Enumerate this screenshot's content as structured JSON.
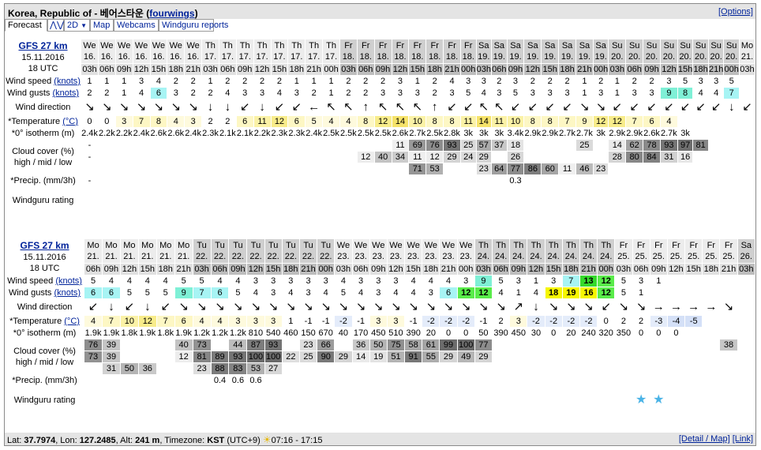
{
  "title": {
    "location": "Korea, Republic of - 베어스타운",
    "open_paren": "(",
    "user": "fourwings",
    "close_paren": ")"
  },
  "options_label": "[Options]",
  "tabs": {
    "forecast": "Forecast",
    "graph": "⋀⋁",
    "dim": "2D",
    "map": "Map",
    "webcams": "Webcams",
    "reports": "Windguru reports"
  },
  "row_labels": {
    "wind_speed": "Wind speed",
    "wind_speed_unit": "(knots)",
    "wind_gusts": "Wind gusts",
    "wind_gusts_unit": "(knots)",
    "wind_direction": "Wind direction",
    "temperature": "*Temperature",
    "temperature_unit": "(°C)",
    "isotherm": "*0° isotherm (m)",
    "cloud_cover_1": "Cloud cover (%)",
    "cloud_cover_2": "high / mid / low",
    "precip": "*Precip. (mm/3h)",
    "rating": "Windguru rating"
  },
  "blocks": [
    {
      "model": "GFS 27 km",
      "date": "15.11.2016",
      "utc": "18 UTC",
      "days": [
        "We",
        "We",
        "We",
        "We",
        "We",
        "We",
        "We",
        "Th",
        "Th",
        "Th",
        "Th",
        "Th",
        "Th",
        "Th",
        "Th",
        "Fr",
        "Fr",
        "Fr",
        "Fr",
        "Fr",
        "Fr",
        "Fr",
        "Fr",
        "Sa",
        "Sa",
        "Sa",
        "Sa",
        "Sa",
        "Sa",
        "Sa",
        "Sa",
        "Su",
        "Su",
        "Su",
        "Su",
        "Su",
        "Su",
        "Su",
        "Su",
        "Mo"
      ],
      "dates": [
        "16.",
        "16.",
        "16.",
        "16.",
        "16.",
        "16.",
        "16.",
        "17.",
        "17.",
        "17.",
        "17.",
        "17.",
        "17.",
        "17.",
        "17.",
        "18.",
        "18.",
        "18.",
        "18.",
        "18.",
        "18.",
        "18.",
        "18.",
        "19.",
        "19.",
        "19.",
        "19.",
        "19.",
        "19.",
        "19.",
        "19.",
        "20.",
        "20.",
        "20.",
        "20.",
        "20.",
        "20.",
        "20.",
        "20.",
        "21."
      ],
      "hours": [
        "03h",
        "06h",
        "09h",
        "12h",
        "15h",
        "18h",
        "21h",
        "03h",
        "06h",
        "09h",
        "12h",
        "15h",
        "18h",
        "21h",
        "00h",
        "03h",
        "06h",
        "09h",
        "12h",
        "15h",
        "18h",
        "21h",
        "00h",
        "03h",
        "06h",
        "09h",
        "12h",
        "15h",
        "18h",
        "21h",
        "00h",
        "03h",
        "06h",
        "09h",
        "12h",
        "15h",
        "18h",
        "21h",
        "00h",
        "03h"
      ],
      "weekend": [
        0,
        0,
        0,
        0,
        0,
        0,
        0,
        0,
        0,
        0,
        0,
        0,
        0,
        0,
        0,
        1,
        1,
        1,
        1,
        1,
        1,
        1,
        1,
        1,
        1,
        1,
        1,
        1,
        1,
        1,
        1,
        1,
        1,
        1,
        1,
        1,
        1,
        1,
        1,
        0
      ],
      "wind_speed": [
        "1",
        "1",
        "1",
        "3",
        "4",
        "2",
        "2",
        "1",
        "2",
        "2",
        "2",
        "2",
        "1",
        "1",
        "1",
        "2",
        "2",
        "2",
        "3",
        "1",
        "2",
        "4",
        "3",
        "3",
        "2",
        "3",
        "2",
        "2",
        "2",
        "1",
        "2",
        "1",
        "2",
        "2",
        "3",
        "5",
        "3",
        "3",
        "5",
        ""
      ],
      "wind_gusts": [
        "2",
        "2",
        "1",
        "4",
        "6",
        "3",
        "2",
        "2",
        "4",
        "3",
        "3",
        "4",
        "3",
        "2",
        "1",
        "2",
        "2",
        "3",
        "3",
        "3",
        "2",
        "3",
        "5",
        "4",
        "3",
        "5",
        "3",
        "3",
        "3",
        "1",
        "3",
        "1",
        "3",
        "3",
        "9",
        "8",
        "4",
        "4",
        "7",
        ""
      ],
      "wind_dir": [
        "↘",
        "↘",
        "↘",
        "↘",
        "↘",
        "↘",
        "↘",
        "↓",
        "↓",
        "↙",
        "↓",
        "↙",
        "↙",
        "←",
        "↖",
        "↖",
        "↑",
        "↖",
        "↖",
        "↖",
        "↑",
        "↙",
        "↙",
        "↖",
        "↖",
        "↙",
        "↙",
        "↙",
        "↙",
        "↘",
        "↘",
        "↙",
        "↙",
        "↙",
        "↙",
        "↙",
        "↙",
        "↙",
        "↓",
        "↙"
      ],
      "temperature": [
        "0",
        "0",
        "3",
        "7",
        "8",
        "4",
        "3",
        "2",
        "2",
        "6",
        "11",
        "12",
        "6",
        "5",
        "4",
        "4",
        "8",
        "12",
        "14",
        "10",
        "8",
        "8",
        "11",
        "14",
        "11",
        "10",
        "8",
        "8",
        "7",
        "9",
        "12",
        "12",
        "7",
        "6",
        "4",
        "",
        "",
        "",
        "",
        ""
      ],
      "isotherm": [
        "2.4k",
        "2.2k",
        "2.2k",
        "2.4k",
        "2.6k",
        "2.6k",
        "2.4k",
        "2.3k",
        "2.1k",
        "2.1k",
        "2.2k",
        "2.3k",
        "2.3k",
        "2.4k",
        "2.5k",
        "2.5k",
        "2.5k",
        "2.5k",
        "2.6k",
        "2.7k",
        "2.5k",
        "2.8k",
        "3k",
        "3k",
        "3k",
        "3.4k",
        "2.9k",
        "2.9k",
        "2.7k",
        "2.7k",
        "3k",
        "2.9k",
        "2.9k",
        "2.6k",
        "2.7k",
        "3k",
        "",
        "",
        "",
        ""
      ],
      "cloud_high": [
        "-",
        "",
        "",
        "",
        "",
        "",
        "",
        "",
        "",
        "",
        "",
        "",
        "",
        "",
        "",
        "",
        "",
        "",
        "11",
        "69",
        "76",
        "93",
        "25",
        "57",
        "37",
        "18",
        "",
        "",
        "",
        "25",
        "",
        "14",
        "62",
        "78",
        "93",
        "97",
        "81",
        "",
        "",
        ""
      ],
      "cloud_mid": [
        "-",
        "",
        "",
        "",
        "",
        "",
        "",
        "",
        "",
        "",
        "",
        "",
        "",
        "",
        "",
        "",
        "12",
        "40",
        "34",
        "11",
        "12",
        "29",
        "24",
        "29",
        "",
        "26",
        "",
        "",
        "",
        "",
        "",
        "28",
        "80",
        "84",
        "31",
        "16",
        "",
        "",
        "",
        ""
      ],
      "cloud_low": [
        "",
        "",
        "",
        "",
        "",
        "",
        "",
        "",
        "",
        "",
        "",
        "",
        "",
        "",
        "",
        "",
        "",
        "",
        "",
        "71",
        "53",
        "",
        "",
        "23",
        "64",
        "77",
        "86",
        "60",
        "11",
        "46",
        "23",
        "",
        "",
        "",
        "",
        "",
        "",
        "",
        "",
        ""
      ],
      "precip": [
        "-",
        "",
        "",
        "",
        "",
        "",
        "",
        "",
        "",
        "",
        "",
        "",
        "",
        "",
        "",
        "",
        "",
        "",
        "",
        "",
        "",
        "",
        "",
        "",
        "",
        "0.3",
        "",
        "",
        "",
        "",
        "",
        "",
        "",
        "",
        "",
        "",
        "",
        "",
        "",
        ""
      ],
      "rating": [
        "",
        "",
        "",
        "",
        "",
        "",
        "",
        "",
        "",
        "",
        "",
        "",
        "",
        "",
        "",
        "",
        "",
        "",
        "",
        "",
        "",
        "",
        "",
        "",
        "",
        "",
        "",
        "",
        "",
        "",
        "",
        "",
        "",
        "",
        "",
        "",
        "",
        "",
        "",
        ""
      ]
    },
    {
      "model": "GFS 27 km",
      "date": "15.11.2016",
      "utc": "18 UTC",
      "days": [
        "Mo",
        "Mo",
        "Mo",
        "Mo",
        "Mo",
        "Mo",
        "Tu",
        "Tu",
        "Tu",
        "Tu",
        "Tu",
        "Tu",
        "Tu",
        "Tu",
        "We",
        "We",
        "We",
        "We",
        "We",
        "We",
        "We",
        "We",
        "Th",
        "Th",
        "Th",
        "Th",
        "Th",
        "Th",
        "Th",
        "Th",
        "Fr",
        "Fr",
        "Fr",
        "Fr",
        "Fr",
        "Fr",
        "Fr",
        "Sa"
      ],
      "dates": [
        "21.",
        "21.",
        "21.",
        "21.",
        "21.",
        "21.",
        "22.",
        "22.",
        "22.",
        "22.",
        "22.",
        "22.",
        "22.",
        "22.",
        "23.",
        "23.",
        "23.",
        "23.",
        "23.",
        "23.",
        "23.",
        "23.",
        "24.",
        "24.",
        "24.",
        "24.",
        "24.",
        "24.",
        "24.",
        "24.",
        "25.",
        "25.",
        "25.",
        "25.",
        "25.",
        "25.",
        "25.",
        "26."
      ],
      "hours": [
        "06h",
        "09h",
        "12h",
        "15h",
        "18h",
        "21h",
        "03h",
        "06h",
        "09h",
        "12h",
        "15h",
        "18h",
        "21h",
        "00h",
        "03h",
        "06h",
        "09h",
        "12h",
        "15h",
        "18h",
        "21h",
        "00h",
        "03h",
        "06h",
        "09h",
        "12h",
        "15h",
        "18h",
        "21h",
        "00h",
        "03h",
        "06h",
        "09h",
        "12h",
        "15h",
        "18h",
        "21h",
        "03h"
      ],
      "weekend": [
        0,
        0,
        0,
        0,
        0,
        0,
        1,
        1,
        1,
        1,
        1,
        1,
        1,
        1,
        0,
        0,
        0,
        0,
        0,
        0,
        0,
        0,
        1,
        1,
        1,
        1,
        1,
        1,
        1,
        1,
        0,
        0,
        0,
        0,
        0,
        0,
        0,
        1
      ],
      "wind_speed": [
        "5",
        "4",
        "4",
        "4",
        "4",
        "5",
        "5",
        "4",
        "4",
        "3",
        "3",
        "3",
        "3",
        "3",
        "4",
        "3",
        "3",
        "3",
        "4",
        "4",
        "4",
        "3",
        "9",
        "5",
        "3",
        "1",
        "3",
        "7",
        "13",
        "12",
        "5",
        "3",
        "1",
        "",
        "",
        "",
        "",
        ""
      ],
      "wind_gusts": [
        "6",
        "6",
        "5",
        "5",
        "5",
        "9",
        "7",
        "6",
        "5",
        "4",
        "3",
        "4",
        "3",
        "4",
        "5",
        "4",
        "3",
        "4",
        "4",
        "3",
        "6",
        "12",
        "12",
        "4",
        "1",
        "4",
        "18",
        "19",
        "16",
        "12",
        "5",
        "1",
        "",
        "",
        "",
        "",
        "",
        ""
      ],
      "wind_dir": [
        "↙",
        "↓",
        "↙",
        "↓",
        "↙",
        "↘",
        "↘",
        "↘",
        "↘",
        "↘",
        "↘",
        "↘",
        "↘",
        "↘",
        "↘",
        "↘",
        "↘",
        "↘",
        "↘",
        "↘",
        "↘",
        "↘",
        "↘",
        "↘",
        "↗",
        "↓",
        "↘",
        "↘",
        "↘",
        "↙",
        "↘",
        "↘",
        "→",
        "→",
        "→",
        "→",
        "↘",
        ""
      ],
      "temperature": [
        "4",
        "7",
        "10",
        "12",
        "7",
        "6",
        "4",
        "4",
        "3",
        "3",
        "3",
        "1",
        "-1",
        "-1",
        "-2",
        "-1",
        "3",
        "3",
        "-1",
        "-2",
        "-2",
        "-2",
        "-1",
        "2",
        "3",
        "-2",
        "-2",
        "-2",
        "-2",
        "0",
        "2",
        "2",
        "-3",
        "-4",
        "-5",
        "",
        "",
        ""
      ],
      "isotherm": [
        "1.9k",
        "1.9k",
        "1.8k",
        "1.9k",
        "1.8k",
        "1.9k",
        "1.2k",
        "1.2k",
        "1.2k",
        "810",
        "540",
        "460",
        "150",
        "670",
        "40",
        "170",
        "450",
        "510",
        "390",
        "20",
        "0",
        "0",
        "50",
        "390",
        "450",
        "30",
        "0",
        "20",
        "240",
        "320",
        "350",
        "0",
        "0",
        "0",
        "",
        "",
        "",
        ""
      ],
      "cloud_high": [
        "76",
        "39",
        "",
        "",
        "",
        "40",
        "73",
        "",
        "44",
        "87",
        "93",
        "",
        "23",
        "66",
        "",
        "36",
        "50",
        "75",
        "58",
        "61",
        "99",
        "100",
        "77",
        "",
        "",
        "",
        "",
        "",
        "",
        "",
        "",
        "",
        "",
        "",
        "",
        "",
        "38",
        ""
      ],
      "cloud_mid": [
        "73",
        "39",
        "",
        "",
        "",
        "12",
        "81",
        "89",
        "93",
        "100",
        "100",
        "22",
        "25",
        "90",
        "29",
        "14",
        "19",
        "51",
        "91",
        "55",
        "29",
        "49",
        "29",
        "",
        "",
        "",
        "",
        "",
        "",
        "",
        "",
        "",
        "",
        "",
        "",
        "",
        "",
        ""
      ],
      "cloud_low": [
        "",
        "31",
        "50",
        "36",
        "",
        "",
        "23",
        "88",
        "83",
        "53",
        "27",
        "",
        "",
        "",
        "",
        "",
        "",
        "",
        "",
        "",
        "",
        "",
        "",
        "",
        "",
        "",
        "",
        "",
        "",
        "",
        "",
        "",
        "",
        "",
        "",
        "",
        "",
        ""
      ],
      "precip": [
        "",
        "",
        "",
        "",
        "",
        "",
        "",
        "0.4",
        "0.6",
        "0.6",
        "",
        "",
        "",
        "",
        "",
        "",
        "",
        "",
        "",
        "",
        "",
        "",
        "",
        "",
        "",
        "",
        "",
        "",
        "",
        "",
        "",
        "",
        "",
        "",
        "",
        "",
        "",
        ""
      ],
      "rating": [
        "",
        "",
        "",
        "",
        "",
        "",
        "",
        "",
        "",
        "",
        "",
        "",
        "",
        "",
        "",
        "",
        "",
        "",
        "",
        "",
        "",
        "",
        "",
        "",
        "",
        "",
        "",
        "",
        "",
        "",
        "",
        "★",
        "★",
        "",
        "",
        "",
        "",
        ""
      ]
    }
  ],
  "footer": {
    "lat_label": "Lat:",
    "lat": "37.7974",
    "lon_label": ", Lon:",
    "lon": "127.2485",
    "alt_label": ", Alt:",
    "alt": "241 m",
    "tz_label": ", Timezone:",
    "tz": "KST",
    "tz_offset": "(UTC+9)",
    "sun_times": "07:16 - 17:15",
    "detail_link": "[Detail / Map]",
    "link_link": "[Link]"
  }
}
